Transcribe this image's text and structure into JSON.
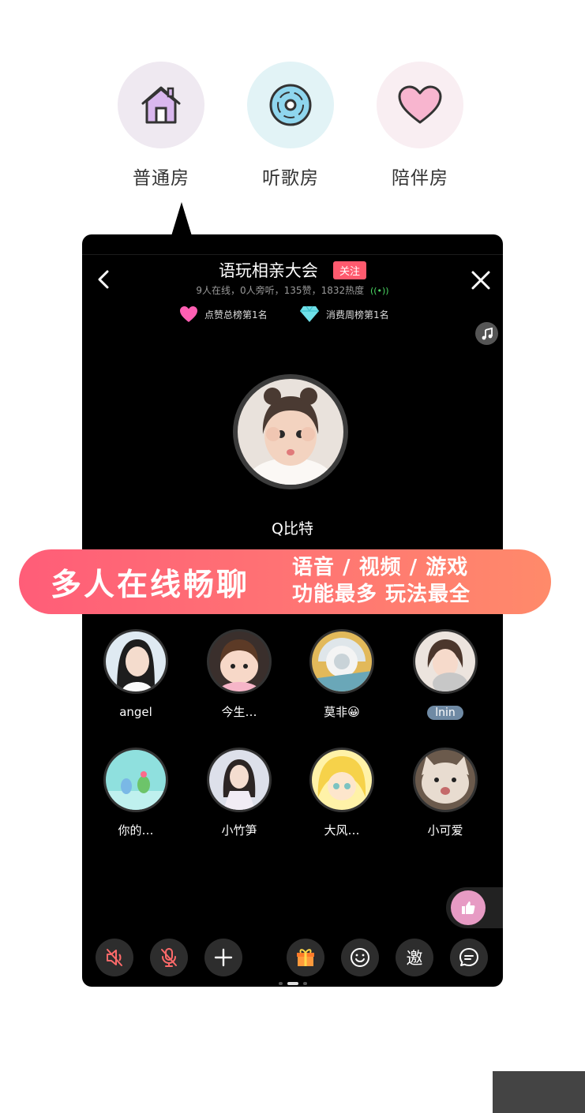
{
  "room_types": [
    {
      "label": "普通房",
      "icon": "house-icon"
    },
    {
      "label": "听歌房",
      "icon": "music-disc-icon"
    },
    {
      "label": "陪伴房",
      "icon": "heart-icon"
    }
  ],
  "room": {
    "title": "语玩相亲大会",
    "follow_label": "关注",
    "stats": "9人在线，0人旁听，135赞，1832热度",
    "ranks": [
      {
        "label": "点赞总榜第1名",
        "icon": "heart-icon"
      },
      {
        "label": "消费周榜第1名",
        "icon": "diamond-icon"
      }
    ],
    "host_name": "Q比特"
  },
  "banner": {
    "main": "多人在线畅聊",
    "sub_line1": "语音 / 视频 / 游戏",
    "sub_line2": "功能最多 玩法最全"
  },
  "seats": [
    {
      "name": "angel"
    },
    {
      "name": "今生…"
    },
    {
      "name": "莫非😀"
    },
    {
      "name": "lnin"
    },
    {
      "name": "你的…"
    },
    {
      "name": "小竹笋"
    },
    {
      "name": "大风…"
    },
    {
      "name": "小可爱"
    }
  ],
  "toolbar": {
    "invite_label": "邀"
  },
  "colors": {
    "follow": "#ff5a6e",
    "banner_start": "#ff5d78",
    "banner_end": "#ff8a6a",
    "like": "#e79bc4"
  }
}
